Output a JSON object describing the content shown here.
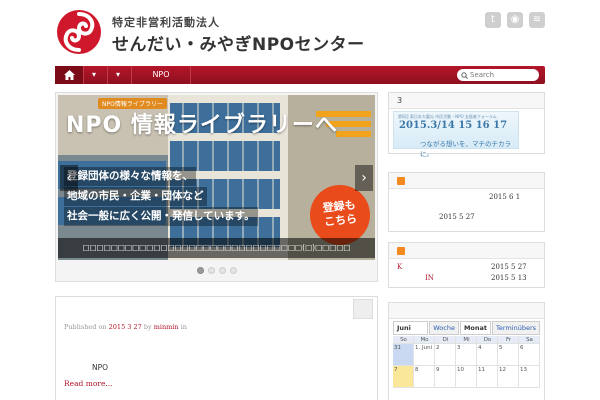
{
  "header": {
    "org_sub": "特定非営利活動法人",
    "org_title": "せんだい・みやぎNPOセンター"
  },
  "social": [
    "twitter-icon",
    "map-pin-icon",
    "rss-icon"
  ],
  "nav": {
    "items": [
      "NPO"
    ],
    "search_placeholder": "Search"
  },
  "slider": {
    "tag": "NPO情報ライブラリー",
    "title": "NPO 情報ライブラリーへ",
    "lines": [
      "登録団体の様々な情報を、",
      "地域の市民・企業・団体など",
      "社会一般に広く公開・発信しています。"
    ],
    "bubble_lines": [
      "登録も",
      "こちら"
    ],
    "caption": "□□□□□□□□□□□□□□□□□□□□□□□□□□□□□□□(□)□□□□□",
    "dots": 4,
    "active_dot": 0
  },
  "post": {
    "meta_published": "Published on",
    "meta_date": "2015 3 27",
    "meta_by": "by",
    "meta_author": "minmin",
    "meta_in": "in",
    "body": "NPO",
    "read_more": "Read more..."
  },
  "widget1": {
    "title": "3",
    "banner_small": "第6回 東日本大震災 市民活動・NPO 支援者フォーラム",
    "banner_dates": "2015.3/14 15 16 17",
    "banner_tagline": "つながる想いを、マチのチカラに。"
  },
  "widget2": {
    "rows": [
      {
        "date": "2015 6 1"
      },
      {
        "date": "2015 5 27"
      }
    ]
  },
  "widget3": {
    "rows": [
      {
        "label": "K",
        "date": "2015 5 27"
      },
      {
        "label": "IN",
        "date": "2015 5 13"
      }
    ]
  },
  "calendar": {
    "month": "Juni 2015",
    "tabs": [
      "Woche",
      "Monat",
      "Terminübers"
    ],
    "days": [
      "So",
      "Mo",
      "Di",
      "Mi",
      "Do",
      "Fr",
      "Sa"
    ],
    "week1": [
      "31",
      "1. Juni",
      "2",
      "3",
      "4",
      "5",
      "6"
    ],
    "week2": [
      "7",
      "8",
      "9",
      "10",
      "11",
      "12",
      "13"
    ]
  }
}
